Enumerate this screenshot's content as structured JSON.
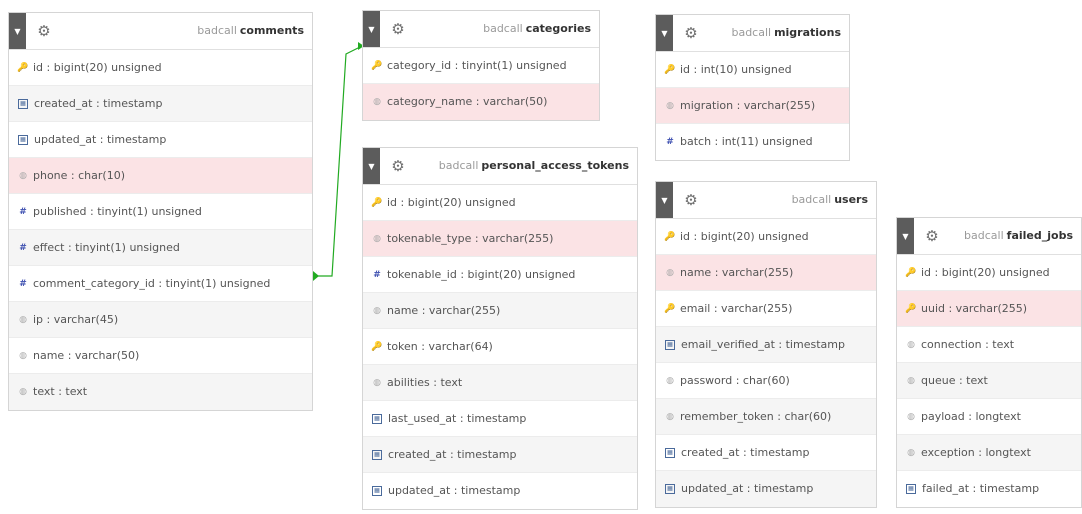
{
  "db_name": "badcall",
  "tables": [
    {
      "name": "comments",
      "columns": [
        {
          "icon": "key-icon",
          "text": "id : bigint(20) unsigned",
          "hl": false
        },
        {
          "icon": "calendar-icon",
          "text": "created_at : timestamp",
          "hl": false
        },
        {
          "icon": "calendar-icon",
          "text": "updated_at : timestamp",
          "hl": false
        },
        {
          "icon": "string-icon",
          "text": "phone : char(10)",
          "hl": true
        },
        {
          "icon": "number-icon",
          "text": "published : tinyint(1) unsigned",
          "hl": false
        },
        {
          "icon": "number-icon",
          "text": "effect : tinyint(1) unsigned",
          "hl": false
        },
        {
          "icon": "number-icon",
          "text": "comment_category_id : tinyint(1) unsigned",
          "hl": false
        },
        {
          "icon": "string-icon",
          "text": "ip : varchar(45)",
          "hl": false
        },
        {
          "icon": "string-icon",
          "text": "name : varchar(50)",
          "hl": false
        },
        {
          "icon": "string-icon",
          "text": "text : text",
          "hl": false
        }
      ]
    },
    {
      "name": "categories",
      "columns": [
        {
          "icon": "key-icon",
          "text": "category_id : tinyint(1) unsigned",
          "hl": false
        },
        {
          "icon": "string-icon",
          "text": "category_name : varchar(50)",
          "hl": true
        }
      ]
    },
    {
      "name": "personal_access_tokens",
      "columns": [
        {
          "icon": "key-icon",
          "text": "id : bigint(20) unsigned",
          "hl": false
        },
        {
          "icon": "string-icon",
          "text": "tokenable_type : varchar(255)",
          "hl": true
        },
        {
          "icon": "number-icon",
          "text": "tokenable_id : bigint(20) unsigned",
          "hl": false
        },
        {
          "icon": "string-icon",
          "text": "name : varchar(255)",
          "hl": false
        },
        {
          "icon": "key-icon",
          "text": "token : varchar(64)",
          "hl": false
        },
        {
          "icon": "string-icon",
          "text": "abilities : text",
          "hl": false
        },
        {
          "icon": "calendar-icon",
          "text": "last_used_at : timestamp",
          "hl": false
        },
        {
          "icon": "calendar-icon",
          "text": "created_at : timestamp",
          "hl": false
        },
        {
          "icon": "calendar-icon",
          "text": "updated_at : timestamp",
          "hl": false
        }
      ]
    },
    {
      "name": "migrations",
      "columns": [
        {
          "icon": "key-icon",
          "text": "id : int(10) unsigned",
          "hl": false
        },
        {
          "icon": "string-icon",
          "text": "migration : varchar(255)",
          "hl": true
        },
        {
          "icon": "number-icon",
          "text": "batch : int(11) unsigned",
          "hl": false
        }
      ]
    },
    {
      "name": "users",
      "columns": [
        {
          "icon": "key-icon",
          "text": "id : bigint(20) unsigned",
          "hl": false
        },
        {
          "icon": "string-icon",
          "text": "name : varchar(255)",
          "hl": true
        },
        {
          "icon": "key-icon",
          "text": "email : varchar(255)",
          "hl": false
        },
        {
          "icon": "calendar-icon",
          "text": "email_verified_at : timestamp",
          "hl": false
        },
        {
          "icon": "string-icon",
          "text": "password : char(60)",
          "hl": false
        },
        {
          "icon": "string-icon",
          "text": "remember_token : char(60)",
          "hl": false
        },
        {
          "icon": "calendar-icon",
          "text": "created_at : timestamp",
          "hl": false
        },
        {
          "icon": "calendar-icon",
          "text": "updated_at : timestamp",
          "hl": false
        }
      ]
    },
    {
      "name": "failed_jobs",
      "columns": [
        {
          "icon": "key-icon",
          "text": "id : bigint(20) unsigned",
          "hl": false
        },
        {
          "icon": "key-icon",
          "text": "uuid : varchar(255)",
          "hl": true
        },
        {
          "icon": "string-icon",
          "text": "connection : text",
          "hl": false
        },
        {
          "icon": "string-icon",
          "text": "queue : text",
          "hl": false
        },
        {
          "icon": "string-icon",
          "text": "payload : longtext",
          "hl": false
        },
        {
          "icon": "string-icon",
          "text": "exception : longtext",
          "hl": false
        },
        {
          "icon": "calendar-icon",
          "text": "failed_at : timestamp",
          "hl": false
        }
      ]
    }
  ],
  "relation_color": "#22aa22",
  "highlight_color": "#fbe3e5"
}
